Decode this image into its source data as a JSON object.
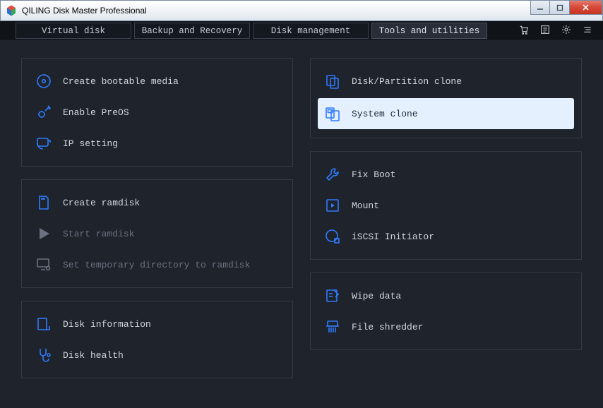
{
  "window": {
    "title": "QILING Disk Master Professional"
  },
  "tabs": {
    "virtual_disk": "Virtual disk",
    "backup_recovery": "Backup and Recovery",
    "disk_management": "Disk management",
    "tools_utilities": "Tools and utilities"
  },
  "left": {
    "g1": {
      "bootable": "Create bootable media",
      "preos": "Enable PreOS",
      "ip": "IP setting"
    },
    "g2": {
      "create_ram": "Create ramdisk",
      "start_ram": "Start ramdisk",
      "tmpdir": "Set temporary directory to ramdisk"
    },
    "g3": {
      "disk_info": "Disk information",
      "disk_health": "Disk health"
    }
  },
  "right": {
    "g1": {
      "dp_clone": "Disk/Partition clone",
      "sys_clone": "System clone"
    },
    "g2": {
      "fixboot": "Fix Boot",
      "mount": "Mount",
      "iscsi": "iSCSI Initiator"
    },
    "g3": {
      "wipe": "Wipe data",
      "shred": "File shredder"
    }
  }
}
